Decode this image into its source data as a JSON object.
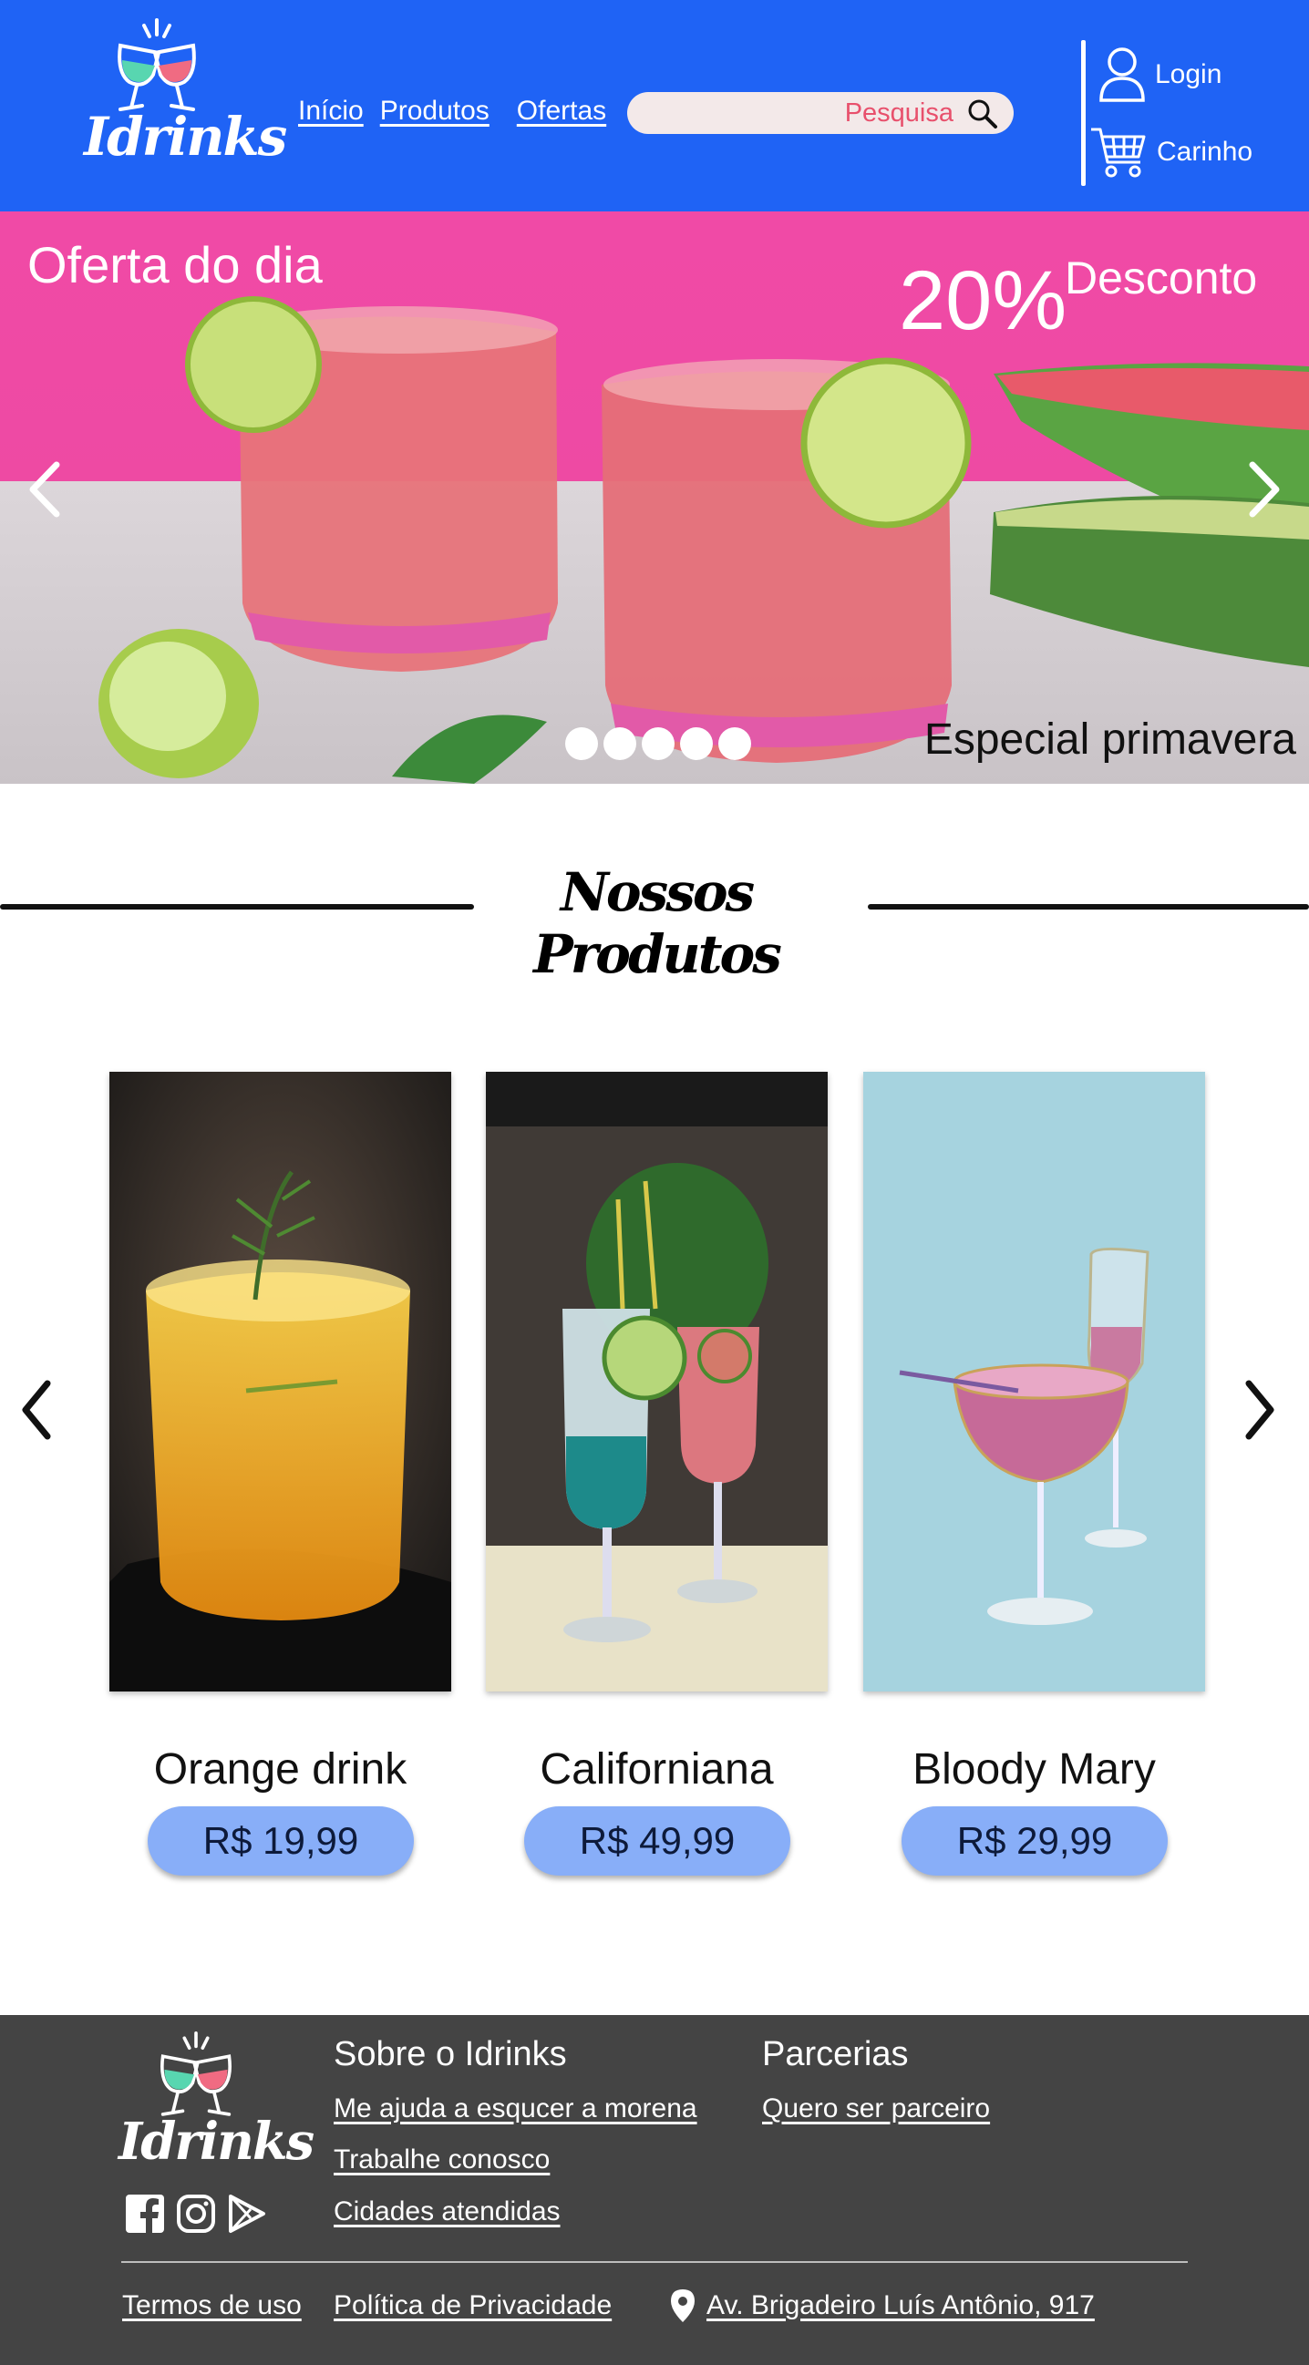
{
  "header": {
    "logo_text": "Idrinks",
    "nav": [
      {
        "label": "Início"
      },
      {
        "label": "Produtos"
      },
      {
        "label": "Ofertas"
      }
    ],
    "search_placeholder": "Pesquisa",
    "login_label": "Login",
    "cart_label": "Carinho",
    "colors": {
      "background": "#1f63f5",
      "search_text": "#e8506c"
    }
  },
  "hero": {
    "title": "Oferta do dia",
    "discount_pct": "20%",
    "discount_label": "Desconto",
    "subtitle": "Especial primavera",
    "dot_count": 5,
    "icons": [
      "chevron-left-icon",
      "chevron-right-icon"
    ]
  },
  "section": {
    "title": "Nossos Produtos"
  },
  "products": [
    {
      "name": "Orange drink",
      "price": "R$ 19,99"
    },
    {
      "name": "Californiana",
      "price": "R$ 49,99"
    },
    {
      "name": "Bloody Mary",
      "price": "R$ 29,99"
    }
  ],
  "footer": {
    "logo_text": "Idrinks",
    "about_heading": "Sobre o Idrinks",
    "about_links": [
      {
        "label": "Me ajuda a esqucer a morena"
      },
      {
        "label": "Trabalhe conosco"
      },
      {
        "label": "Cidades atendidas"
      }
    ],
    "partners_heading": "Parcerias",
    "partners_links": [
      {
        "label": "Quero ser parceiro"
      }
    ],
    "terms": "Termos de uso",
    "privacy": "Política de Privacidade",
    "address": "Av. Brigadeiro Luís Antônio, 917",
    "social_icons": [
      "facebook-icon",
      "instagram-icon",
      "play-store-icon"
    ],
    "colors": {
      "background": "#444444"
    }
  }
}
